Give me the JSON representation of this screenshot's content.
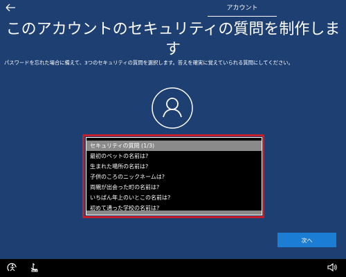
{
  "header": {
    "back_icon": "back-arrow-icon",
    "tab_label": "アカウント"
  },
  "main": {
    "title": "このアカウントのセキュリティの質問を制作します",
    "description": "パスワードを忘れた場合に備えて、3つのセキュリティの質問を選択します。答えを確実に覚えていられる質問にしてください。",
    "avatar_icon": "user-icon"
  },
  "dropdown": {
    "selected": "セキュリティの質問 (1/3)",
    "options": [
      "最初のペットの名前は?",
      "生まれた場所の名前は?",
      "子供のころのニックネームは?",
      "両親が出会った町の名前は?",
      "いちばん年上のいとこの名前は?",
      "初めて通った学校の名前は?"
    ]
  },
  "footer": {
    "next_label": "次へ",
    "icons": [
      "ease-of-access-icon",
      "accessibility-input-icon",
      "volume-icon"
    ]
  },
  "colors": {
    "background": "#1e3f72",
    "accent": "#1b7dd4",
    "highlight": "#c81e2a"
  }
}
